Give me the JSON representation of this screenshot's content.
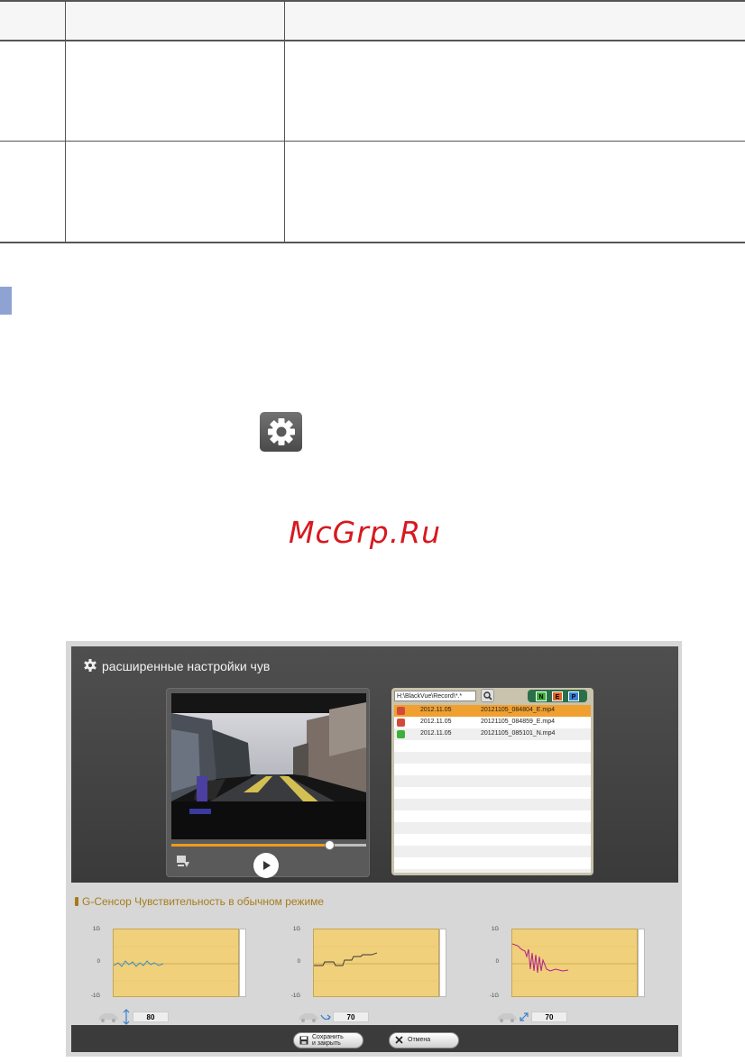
{
  "doc": {
    "watermark": "McGrp.Ru"
  },
  "window": {
    "title": "расширенные настройки чув",
    "player": {
      "progress": 0.81
    },
    "files": {
      "path": "H:\\BlackVue\\Record\\*.*",
      "filters": [
        "N",
        "E",
        "P"
      ],
      "rows": [
        {
          "date": "2012.11.05",
          "name": "20121105_084804_E.mp4",
          "type": "event",
          "selected": true
        },
        {
          "date": "2012.11.05",
          "name": "20121105_084859_E.mp4",
          "type": "event",
          "selected": false
        },
        {
          "date": "2012.11.05",
          "name": "20121105_085101_N.mp4",
          "type": "normal",
          "selected": false
        }
      ]
    },
    "sensor": {
      "title": "G-Сенсор Чувствительность в обычном режиме",
      "axis": {
        "top": "1G",
        "mid": "0",
        "bottom": "-1G"
      },
      "graphs": [
        {
          "id": "vertical",
          "value": "80"
        },
        {
          "id": "lateral",
          "value": "70"
        },
        {
          "id": "longitudinal",
          "value": "70"
        }
      ]
    },
    "buttons": {
      "save": "Сохранить\nи закрыть",
      "cancel": "Отмена"
    }
  }
}
